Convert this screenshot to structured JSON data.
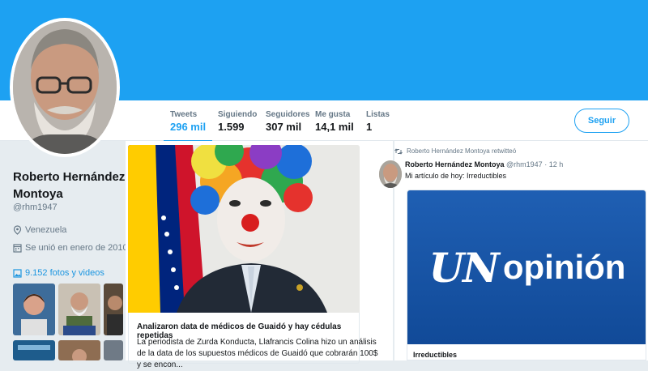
{
  "header": {
    "tabs": [
      {
        "label": "Tweets",
        "value": "296 mil"
      },
      {
        "label": "Siguiendo",
        "value": "1.599"
      },
      {
        "label": "Seguidores",
        "value": "307 mil"
      },
      {
        "label": "Me gusta",
        "value": "14,1 mil"
      },
      {
        "label": "Listas",
        "value": "1"
      }
    ],
    "follow_label": "Seguir"
  },
  "profile": {
    "name": "Roberto Hernández Montoya",
    "handle": "@rhm1947",
    "location": "Venezuela",
    "joined": "Se unió en enero de 2010",
    "photos_link": "9.152 fotos y videos"
  },
  "feed": {
    "card": {
      "title": "Analizaron data de médicos de Guaidó y hay cédulas repetidas",
      "description": "La periodista de Zurda Konducta, Llafrancis Colina hizo un análisis de la data de los supuestos médicos de Guaidó que cobrarán 100$ y se encon..."
    },
    "retweet": {
      "retweeted_by": "Roberto Hernández Montoya retwitteó",
      "author_name": "Roberto Hernández Montoya",
      "author_handle": "@rhm1947",
      "time": "12 h",
      "text": "Mi artículo de hoy: Irreductibles",
      "card_logo_un": "UN",
      "card_logo_word": "opinión",
      "card_title": "Irreductibles"
    }
  },
  "colors": {
    "accent": "#1da1f2",
    "banner": "#1da1f2",
    "card_blue": "#1f5fb3"
  }
}
